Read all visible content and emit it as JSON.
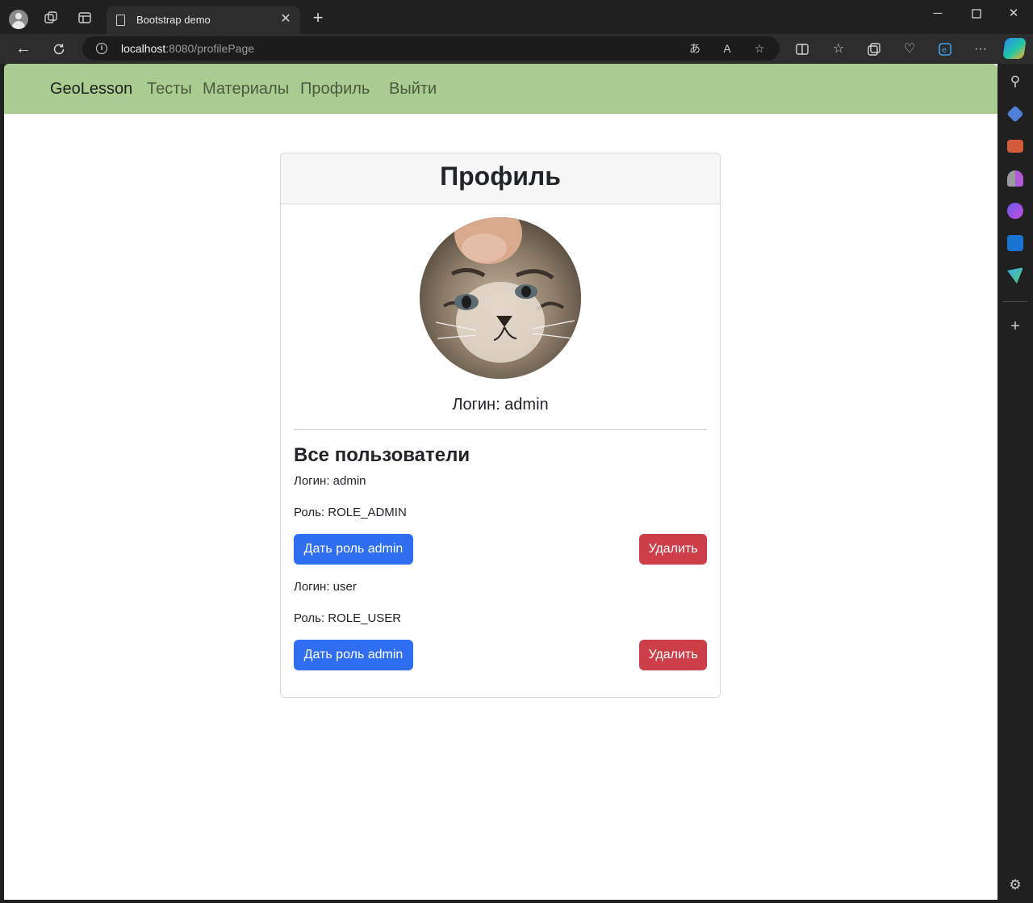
{
  "browser": {
    "tab_title": "Bootstrap demo",
    "url_host": "localhost",
    "url_rest": ":8080/profilePage"
  },
  "site_nav": {
    "brand": "GeoLesson",
    "links": [
      "Тесты",
      "Материалы",
      "Профиль",
      "Выйти"
    ]
  },
  "profile": {
    "title": "Профиль",
    "login_line": "Логин: admin",
    "users_title": "Все пользователи",
    "users": [
      {
        "login_line": "Логин: admin",
        "role_line": "Роль: ROLE_ADMIN",
        "grant_label": "Дать роль admin",
        "delete_label": "Удалить"
      },
      {
        "login_line": "Логин: user",
        "role_line": "Роль: ROLE_USER",
        "grant_label": "Дать роль admin",
        "delete_label": "Удалить"
      }
    ]
  },
  "colors": {
    "navbar": "#a9cc91",
    "primary": "#2f6ef0",
    "danger": "#cc3f48"
  }
}
